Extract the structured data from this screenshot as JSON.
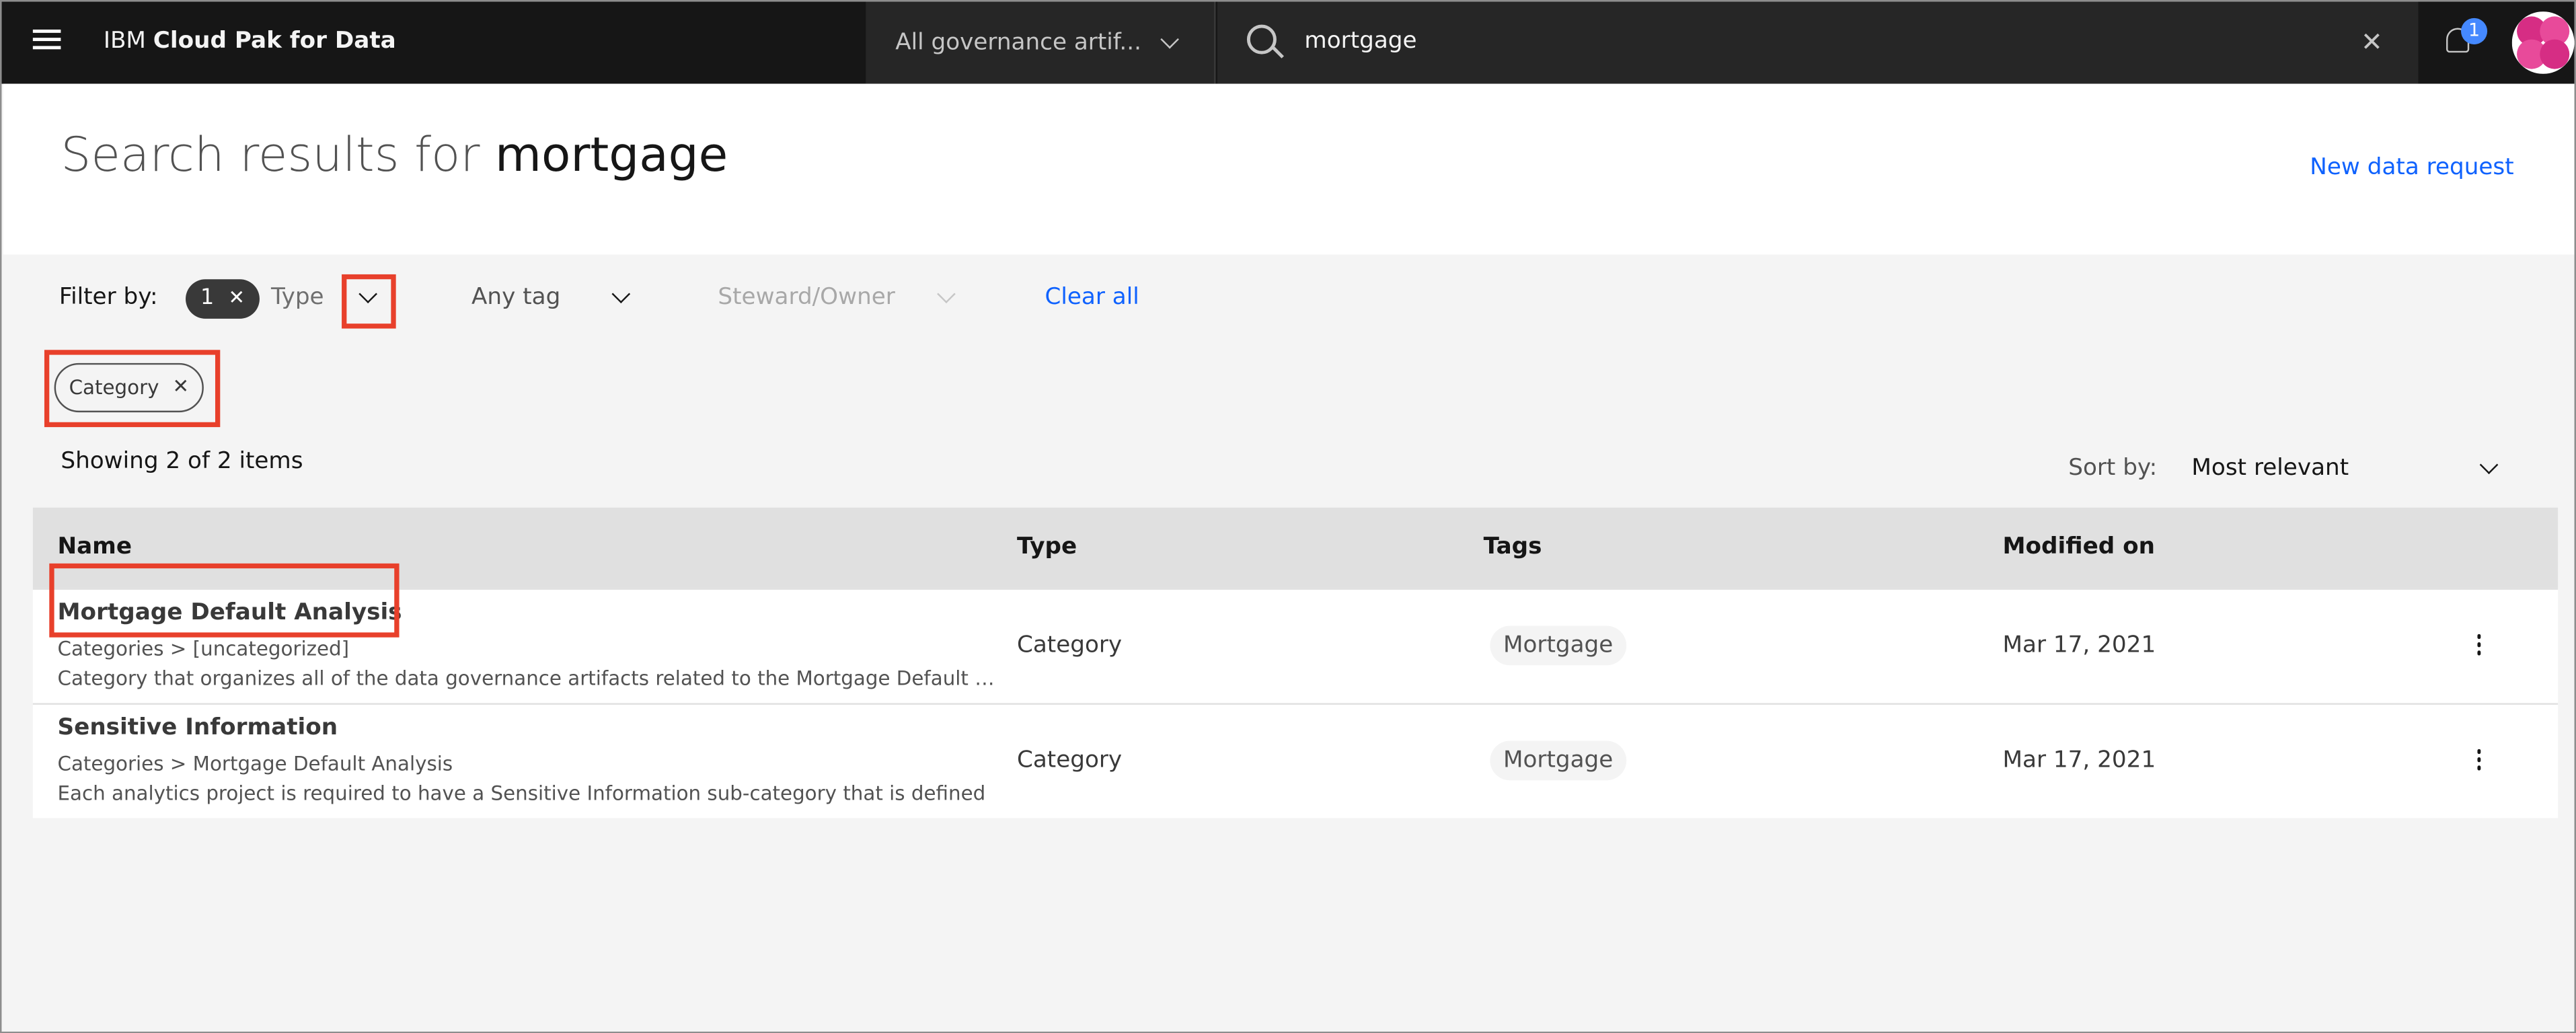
{
  "header": {
    "brand_prefix": "IBM",
    "brand_name": "Cloud Pak for Data",
    "scope_select": "All governance artif...",
    "search_value": "mortgage",
    "notification_count": "1"
  },
  "page": {
    "title_prefix": "Search results for",
    "title_query": "mortgage",
    "new_request_label": "New data request"
  },
  "filters": {
    "label": "Filter by:",
    "type_count": "1",
    "type_label": "Type",
    "tag_label": "Any tag",
    "steward_label": "Steward/Owner",
    "clear_label": "Clear all",
    "active_chip": "Category"
  },
  "results": {
    "summary": "Showing 2 of 2 items",
    "sort_label": "Sort by:",
    "sort_value": "Most relevant"
  },
  "table": {
    "columns": [
      "Name",
      "Type",
      "Tags",
      "Modified on"
    ],
    "rows": [
      {
        "name": "Mortgage Default Analysis",
        "path": "Categories > [uncategorized]",
        "description": "Category that organizes all of the data governance artifacts related to the Mortgage Default Analysis",
        "type": "Category",
        "tag": "Mortgage",
        "modified": "Mar 17, 2021"
      },
      {
        "name": "Sensitive Information",
        "path": "Categories > Mortgage Default Analysis",
        "description": "Each analytics project is required to have a Sensitive Information sub-category that is defined",
        "type": "Category",
        "tag": "Mortgage",
        "modified": "Mar 17, 2021"
      }
    ]
  },
  "colors": {
    "header_bg": "#161616",
    "link": "#0f62fe",
    "highlight": "#e8402b",
    "badge": "#4589ff"
  }
}
